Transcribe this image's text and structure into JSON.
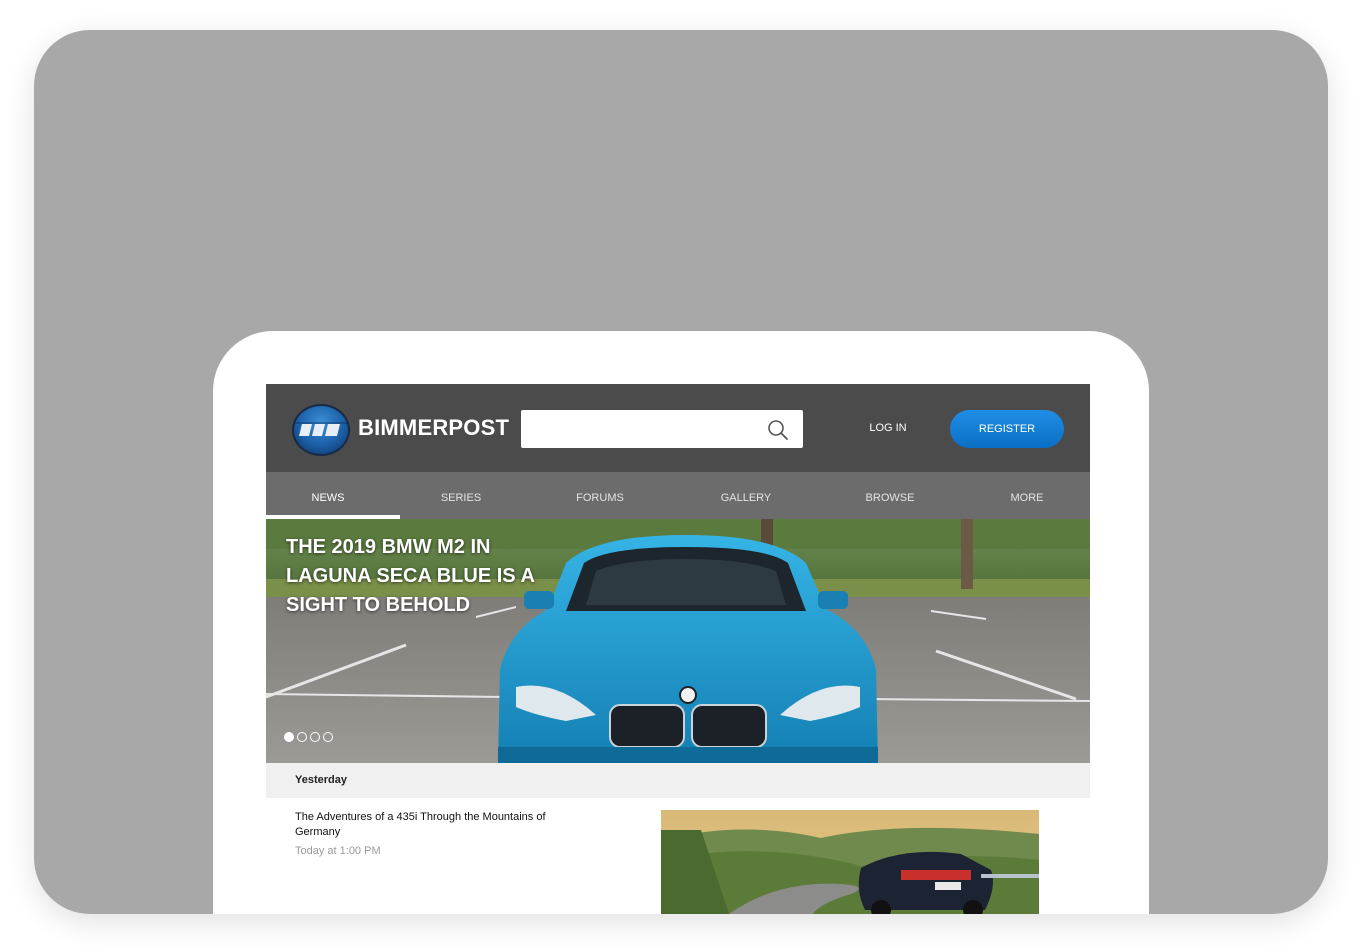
{
  "brand": {
    "name": "BIMMERPOST"
  },
  "header": {
    "search_value": "",
    "login_label": "LOG IN",
    "register_label": "REGISTER"
  },
  "nav": {
    "items": [
      {
        "label": "NEWS",
        "active": true
      },
      {
        "label": "SERIES",
        "active": false
      },
      {
        "label": "FORUMS",
        "active": false
      },
      {
        "label": "GALLERY",
        "active": false
      },
      {
        "label": "BROWSE",
        "active": false
      },
      {
        "label": "MORE",
        "active": false
      }
    ]
  },
  "hero": {
    "title": "THE 2019 BMW M2 IN LAGUNA SECA BLUE IS A SIGHT TO BEHOLD",
    "slide_count": 4,
    "active_slide": 1
  },
  "feed": {
    "date_label": "Yesterday",
    "articles": [
      {
        "title": "The Adventures of a 435i Through the Mountains of Germany",
        "time": "Today at 1:00 PM"
      }
    ]
  },
  "colors": {
    "backdrop": "#a8a8a8",
    "header_bg": "#4b4b4b",
    "nav_bg": "#6c6c6c",
    "register_blue": "#0a6fc4",
    "car_blue": "#1c9bd0"
  }
}
